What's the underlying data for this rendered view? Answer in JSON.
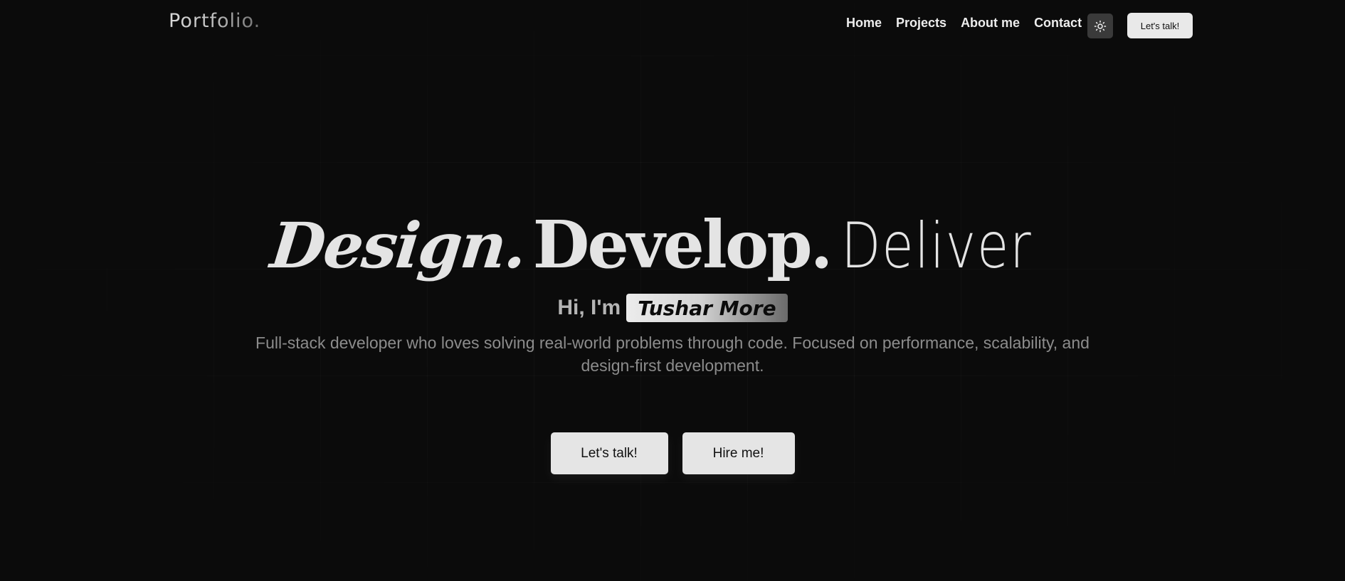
{
  "nav": {
    "logo": "Portfolio.",
    "links": [
      "Home",
      "Projects",
      "About me",
      "Contact"
    ],
    "theme_icon": "sun-icon",
    "cta_label": "Let's talk!"
  },
  "hero": {
    "title_design": "Design.",
    "title_develop": "Develop.",
    "title_deliver": "Deliver",
    "greeting": "Hi, I'm",
    "name": "Tushar More",
    "description": "Full-stack developer who loves solving real-world problems through code. Focused on performance, scalability, and design-first development.",
    "primary_cta": "Let's talk!",
    "secondary_cta": "Hire me!"
  },
  "colors": {
    "background": "#0b0b0b",
    "text": "#e4e4e4",
    "muted": "#8c8c8c",
    "button": "#e5e5e5"
  }
}
